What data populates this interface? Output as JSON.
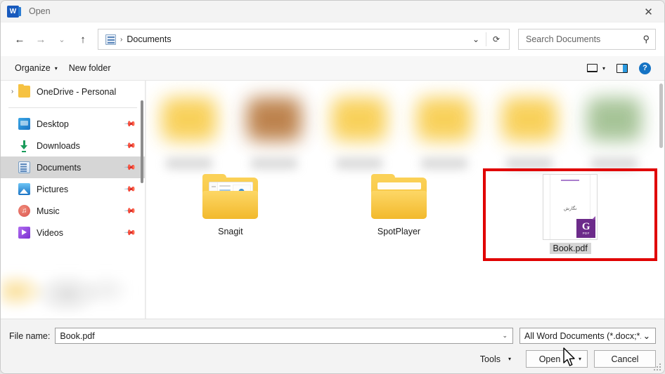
{
  "window": {
    "title": "Open",
    "app_icon": "word-icon",
    "close_label": "✕"
  },
  "nav": {
    "back": "←",
    "forward": "→",
    "recent": "⌄",
    "up": "↑",
    "breadcrumb": {
      "icon": "documents-icon",
      "separator": "›",
      "path": "Documents"
    },
    "history_caret": "⌄",
    "refresh": "⟳"
  },
  "search": {
    "placeholder": "Search Documents",
    "value": "",
    "icon": "search-icon"
  },
  "commandbar": {
    "organize": "Organize",
    "organize_caret": "▾",
    "new_folder": "New folder",
    "view_caret": "▾",
    "help": "?"
  },
  "sidebar": {
    "onedrive": {
      "chevron": "›",
      "label": "OneDrive - Personal"
    },
    "items": [
      {
        "label": "Desktop",
        "icon": "desktop-icon",
        "pinned": true,
        "selected": false
      },
      {
        "label": "Downloads",
        "icon": "downloads-icon",
        "pinned": true,
        "selected": false
      },
      {
        "label": "Documents",
        "icon": "documents-icon",
        "pinned": true,
        "selected": true
      },
      {
        "label": "Pictures",
        "icon": "pictures-icon",
        "pinned": true,
        "selected": false
      },
      {
        "label": "Music",
        "icon": "music-icon",
        "pinned": true,
        "selected": false
      },
      {
        "label": "Videos",
        "icon": "videos-icon",
        "pinned": true,
        "selected": false
      }
    ],
    "pin_glyph": "📌"
  },
  "content": {
    "blurred_row_count": 6,
    "items": [
      {
        "label": "Snagit",
        "type": "folder",
        "selected": false,
        "preview": "explorer"
      },
      {
        "label": "SpotPlayer",
        "type": "folder",
        "selected": false,
        "preview": "plain"
      },
      {
        "label": "Book.pdf",
        "type": "pdf-file",
        "selected": true,
        "badge": "PDF",
        "badge_letter": "G",
        "page_text": "نگارش"
      }
    ]
  },
  "footer": {
    "filename_label": "File name:",
    "filename_value": "Book.pdf",
    "filename_caret": "⌄",
    "filetype_value": "All Word Documents (*.docx;*.",
    "filetype_caret": "⌄",
    "tools_label": "Tools",
    "tools_caret": "▾",
    "open_label": "Open",
    "open_caret": "▾",
    "cancel_label": "Cancel"
  },
  "colors": {
    "accent_blue": "#1573c4",
    "word_blue": "#185abd",
    "selection_red": "#e00000",
    "folder_yellow": "#f6c242",
    "pdf_purple": "#6c2b8a",
    "sidebar_selected": "#d6d6d6"
  }
}
